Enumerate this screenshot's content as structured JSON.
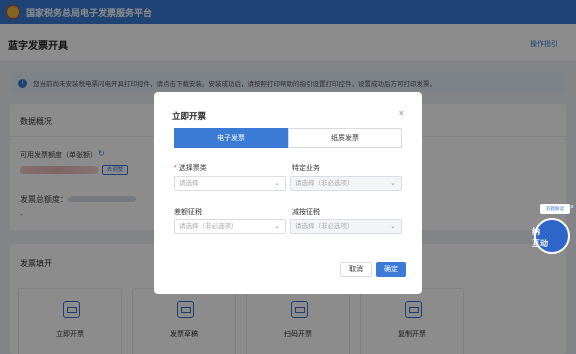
{
  "app": {
    "title": "国家税务总局电子发票服务平台"
  },
  "page": {
    "title": "蓝字发票开具",
    "help": "操作指引"
  },
  "notice": {
    "text": "您当前尚未安装税电票闪电开具打印控件，请点击下载安装。安装成功后，请按照打印帮助的指引设置打印控件，设置成功后方可打印发票。"
  },
  "overview": {
    "title": "数据概况",
    "quota_label": "可用发票额度（单张额）",
    "adjust_button": "去调整",
    "total_label": "发票总额度：",
    "total_value": "-"
  },
  "issuing": {
    "title": "发票填开",
    "tiles": [
      {
        "label": "立即开票",
        "icon": "invoice-icon"
      },
      {
        "label": "发票草稿",
        "icon": "draft-icon"
      },
      {
        "label": "扫码开票",
        "icon": "qrcode-icon"
      },
      {
        "label": "复制开票",
        "icon": "copy-icon"
      }
    ]
  },
  "side_badge": {
    "bubble": "答题解读",
    "line1": "纳",
    "line2": "互",
    "line3": "动"
  },
  "modal": {
    "title": "立即开票",
    "tabs": [
      {
        "label": "电子发票",
        "active": true
      },
      {
        "label": "纸质发票",
        "active": false
      }
    ],
    "fields": {
      "invoice_type": {
        "label": "选择票类",
        "placeholder": "请选择",
        "required": true
      },
      "special_business": {
        "label": "特定业务",
        "placeholder": "请选择（非必选项）"
      },
      "diff_tax": {
        "label": "差额征税",
        "placeholder": "请选择（非必选项）"
      },
      "reduced_tax": {
        "label": "减按征税",
        "placeholder": "请选择（非必选项）"
      }
    },
    "cancel": "取消",
    "confirm": "确定"
  },
  "colors": {
    "accent": "#3b7bd6",
    "required": "#e0453a"
  }
}
